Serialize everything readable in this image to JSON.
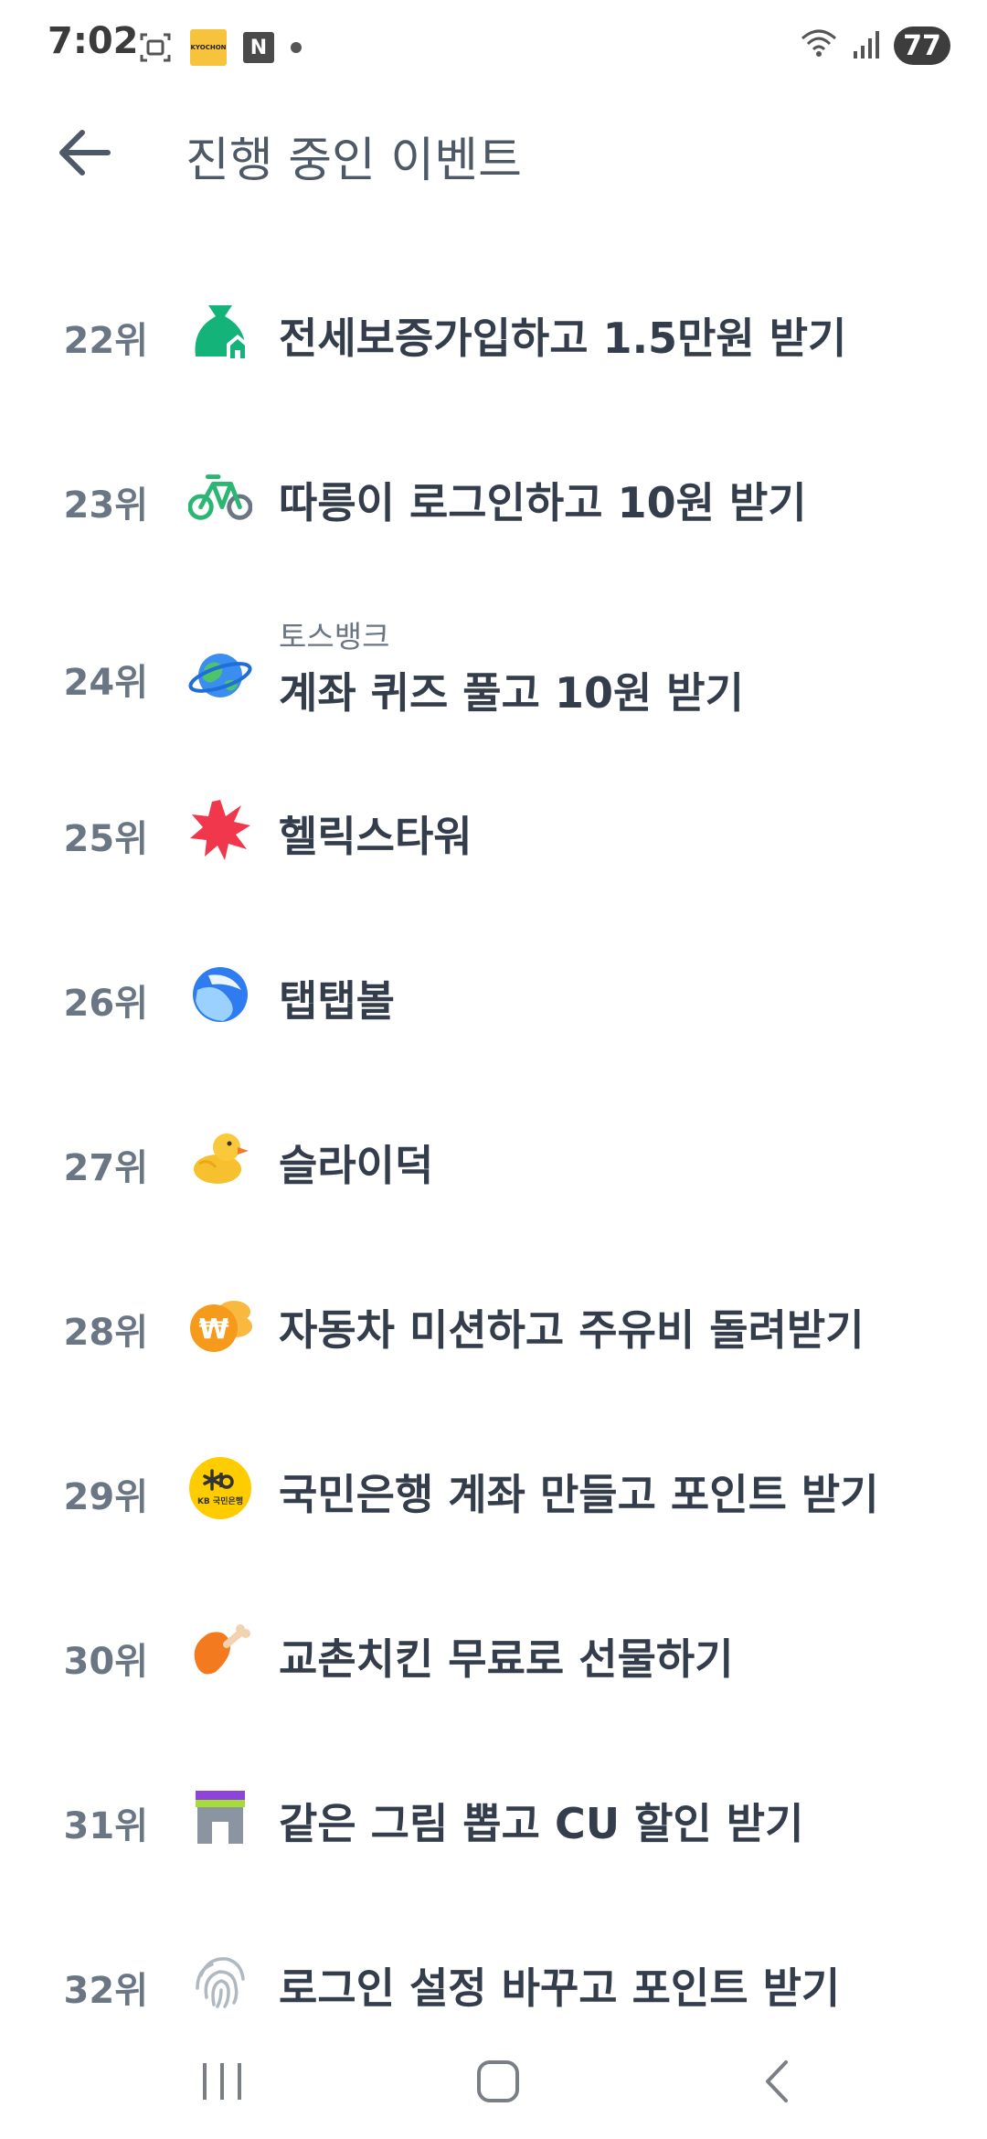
{
  "status_bar": {
    "time": "7:02",
    "kyochon_badge": "KYOCHON",
    "n_badge": "N",
    "battery": "77"
  },
  "header": {
    "title": "진행 중인 이벤트"
  },
  "events": [
    {
      "rank": "22위",
      "title": "전세보증가입하고 1.5만원 받기",
      "icon": "money-bag-house-icon"
    },
    {
      "rank": "23위",
      "title": "따릉이 로그인하고 10원 받기",
      "icon": "bicycle-icon"
    },
    {
      "rank": "24위",
      "subtitle": "토스뱅크",
      "title": "계좌 퀴즈 풀고 10원 받기",
      "icon": "globe-icon"
    },
    {
      "rank": "25위",
      "title": "헬릭스타워",
      "icon": "red-burst-icon"
    },
    {
      "rank": "26위",
      "title": "탭탭볼",
      "icon": "blue-ball-icon"
    },
    {
      "rank": "27위",
      "title": "슬라이덕",
      "icon": "rubber-duck-icon"
    },
    {
      "rank": "28위",
      "title": "자동차 미션하고 주유비 돌려받기",
      "icon": "won-coin-icon"
    },
    {
      "rank": "29위",
      "title": "국민은행 계좌 만들고 포인트 받기",
      "icon": "kb-bank-icon"
    },
    {
      "rank": "30위",
      "title": "교촌치킨 무료로 선물하기",
      "icon": "chicken-leg-icon"
    },
    {
      "rank": "31위",
      "title": "같은 그림 뽑고 CU 할인 받기",
      "icon": "cu-store-icon"
    },
    {
      "rank": "32위",
      "title": "로그인 설정 바꾸고 포인트 받기",
      "icon": "fingerprint-icon"
    }
  ],
  "icon_labels": {
    "kb": "KB 국민은행"
  },
  "colors": {
    "title": "#4e5968",
    "text": "#333d4b",
    "rank": "#6b7684"
  }
}
